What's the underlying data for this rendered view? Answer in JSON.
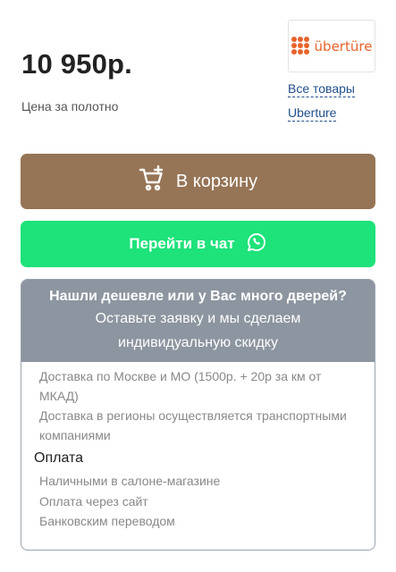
{
  "product": {
    "price": "10 950р.",
    "price_note": "Цена за полотно"
  },
  "brand": {
    "logo_text": "übertüre",
    "all_products_link": "Все товары",
    "brand_link": "Uberture"
  },
  "actions": {
    "cart_label": "В корзину",
    "chat_label": "Перейти в чат"
  },
  "offer": {
    "title": "Нашли дешевле или у Вас много дверей?",
    "subtitle_line1": "Оставьте заявку и мы сделаем",
    "subtitle_line2": "индивидуальную скидку"
  },
  "delivery": {
    "items": [
      "Доставка по Москве и МО (1500р. + 20р за км от МКАД)",
      "Доставка в регионы осуществляется транспортными компаниями"
    ]
  },
  "payment": {
    "title": "Оплата",
    "items": [
      "Наличными в салоне-магазине",
      "Оплата через сайт",
      "Банковским переводом"
    ]
  },
  "colors": {
    "cart_button": "#967456",
    "chat_button": "#1ee27a",
    "offer_header": "#8c95a0",
    "link": "#1f4f8c",
    "brand_orange": "#e8632b"
  },
  "icons": {
    "cart": "cart-plus-icon",
    "chat": "whatsapp-icon",
    "logo": "uberture-logo"
  }
}
